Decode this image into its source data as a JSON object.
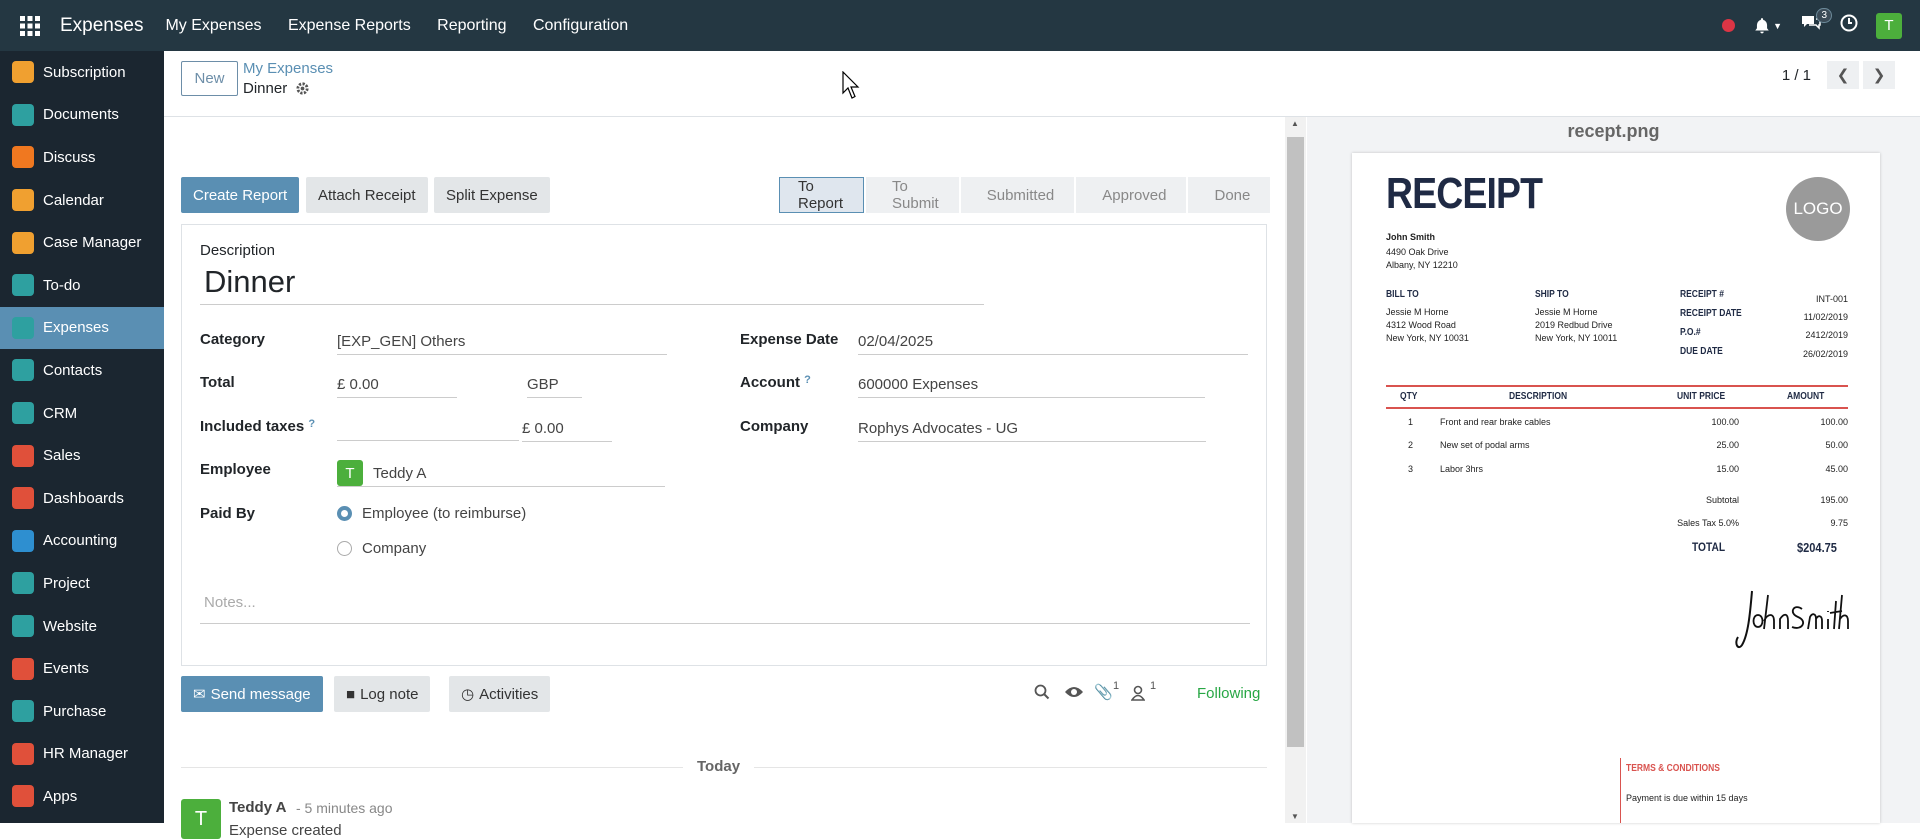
{
  "topbar": {
    "app_name": "Expenses",
    "menu": [
      "My Expenses",
      "Expense Reports",
      "Reporting",
      "Configuration"
    ],
    "message_count": "3",
    "user_initial": "T"
  },
  "sidebar": {
    "items": [
      {
        "label": "Subscription",
        "icon": "subscription-icon",
        "color": "#f0a030"
      },
      {
        "label": "Documents",
        "icon": "documents-icon",
        "color": "#2ea0a0"
      },
      {
        "label": "Discuss",
        "icon": "discuss-icon",
        "color": "#f07820"
      },
      {
        "label": "Calendar",
        "icon": "calendar-icon",
        "color": "#f0a030"
      },
      {
        "label": "Case Manager",
        "icon": "case-manager-icon",
        "color": "#f0a030"
      },
      {
        "label": "To-do",
        "icon": "todo-icon",
        "color": "#2ea0a0"
      },
      {
        "label": "Expenses",
        "icon": "expenses-icon",
        "color": "#2ea0a0"
      },
      {
        "label": "Contacts",
        "icon": "contacts-icon",
        "color": "#2ea0a0"
      },
      {
        "label": "CRM",
        "icon": "crm-icon",
        "color": "#2ea0a0"
      },
      {
        "label": "Sales",
        "icon": "sales-icon",
        "color": "#e0503a"
      },
      {
        "label": "Dashboards",
        "icon": "dashboards-icon",
        "color": "#e0503a"
      },
      {
        "label": "Accounting",
        "icon": "accounting-icon",
        "color": "#2e8fd0"
      },
      {
        "label": "Project",
        "icon": "project-icon",
        "color": "#2ea0a0"
      },
      {
        "label": "Website",
        "icon": "website-icon",
        "color": "#2ea0a0"
      },
      {
        "label": "Events",
        "icon": "events-icon",
        "color": "#e0503a"
      },
      {
        "label": "Purchase",
        "icon": "purchase-icon",
        "color": "#2ea0a0"
      },
      {
        "label": "HR Manager",
        "icon": "hr-manager-icon",
        "color": "#e0503a"
      },
      {
        "label": "Apps",
        "icon": "apps-icon",
        "color": "#e0503a"
      }
    ]
  },
  "control_panel": {
    "new_label": "New",
    "breadcrumb_parent": "My Expenses",
    "breadcrumb_current": "Dinner",
    "pager": "1 / 1"
  },
  "actions": {
    "create_report": "Create Report",
    "attach_receipt": "Attach Receipt",
    "split_expense": "Split Expense"
  },
  "stages": [
    "To Report",
    "To Submit",
    "Submitted",
    "Approved",
    "Done"
  ],
  "form": {
    "description_label": "Description",
    "description": "Dinner",
    "category_label": "Category",
    "category": "[EXP_GEN] Others",
    "total_label": "Total",
    "total": "£ 0.00",
    "currency": "GBP",
    "included_taxes_label": "Included taxes",
    "included_taxes": "£ 0.00",
    "employee_label": "Employee",
    "employee_initial": "T",
    "employee": "Teddy A",
    "paid_by_label": "Paid By",
    "paid_by_employee": "Employee (to reimburse)",
    "paid_by_company": "Company",
    "notes_placeholder": "Notes...",
    "expense_date_label": "Expense Date",
    "expense_date": "02/04/2025",
    "account_label": "Account",
    "account": "600000 Expenses",
    "company_label": "Company",
    "company": "Rophys Advocates - UG"
  },
  "chatter": {
    "send_message": "Send message",
    "log_note": "Log note",
    "activities": "Activities",
    "attachment_count": "1",
    "follower_count": "1",
    "following": "Following",
    "date_separator": "Today",
    "author": "Teddy A",
    "time": "- 5 minutes ago",
    "message": "Expense created",
    "author_initial": "T"
  },
  "preview": {
    "filename": "recept.png",
    "receipt": {
      "title": "RECEIPT",
      "logo": "LOGO",
      "from_lines": [
        "John Smith",
        "4490 Oak Drive",
        "Albany, NY 12210"
      ],
      "bill_to_label": "BILL TO",
      "bill_to": [
        "Jessie M Horne",
        "4312 Wood Road",
        "New York, NY 10031"
      ],
      "ship_to_label": "SHIP TO",
      "ship_to": [
        "Jessie M Horne",
        "2019 Redbud Drive",
        "New York, NY 10011"
      ],
      "meta_labels": [
        "RECEIPT #",
        "RECEIPT DATE",
        "P.O.#",
        "DUE DATE"
      ],
      "meta_values": [
        "INT-001",
        "11/02/2019",
        "2412/2019",
        "26/02/2019"
      ],
      "columns": [
        "QTY",
        "DESCRIPTION",
        "UNIT PRICE",
        "AMOUNT"
      ],
      "rows": [
        [
          "1",
          "Front and rear brake cables",
          "100.00",
          "100.00"
        ],
        [
          "2",
          "New set of podal arms",
          "25.00",
          "50.00"
        ],
        [
          "3",
          "Labor 3hrs",
          "15.00",
          "45.00"
        ]
      ],
      "subtotal_label": "Subtotal",
      "subtotal": "195.00",
      "tax_label": "Sales Tax 5.0%",
      "tax": "9.75",
      "total_label": "TOTAL",
      "total": "$204.75",
      "signature": "John Smith",
      "terms_label": "TERMS & CONDITIONS",
      "terms": "Payment is due within 15 days"
    }
  }
}
